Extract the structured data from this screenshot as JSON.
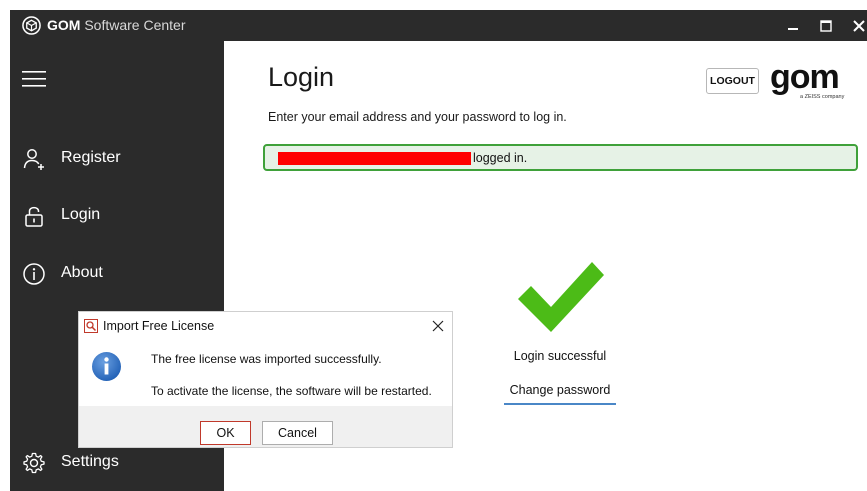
{
  "window": {
    "title_bold": "GOM",
    "title_rest": " Software Center",
    "icons": [
      "app-logo-icon",
      "minimize-icon",
      "maximize-icon",
      "close-icon"
    ]
  },
  "sidebar": {
    "menu_icon": "hamburger-icon",
    "items": [
      {
        "label": "Register",
        "icon": "user-add-icon"
      },
      {
        "label": "Login",
        "icon": "unlock-icon"
      },
      {
        "label": "About",
        "icon": "info-circle-icon"
      },
      {
        "label": "Settings",
        "icon": "gear-icon"
      }
    ]
  },
  "main": {
    "title": "Login",
    "subtitle": "Enter your email address and your password to log in.",
    "logout_label": "LOGOUT",
    "brand": {
      "name": "gom",
      "tagline": "a ZEISS company"
    },
    "status": {
      "text": "logged in.",
      "redacted": true,
      "color": "#3fa13a"
    },
    "success_text": "Login successful",
    "change_password_label": "Change password",
    "accent_color": "#4a87c7",
    "check_color": "#4cbb17"
  },
  "dialog": {
    "title": "Import Free License",
    "message_1": "The free license was imported successfully.",
    "message_2": "To activate the license, the software will be restarted.",
    "ok_label": "OK",
    "cancel_label": "Cancel",
    "icon": "info-icon"
  }
}
